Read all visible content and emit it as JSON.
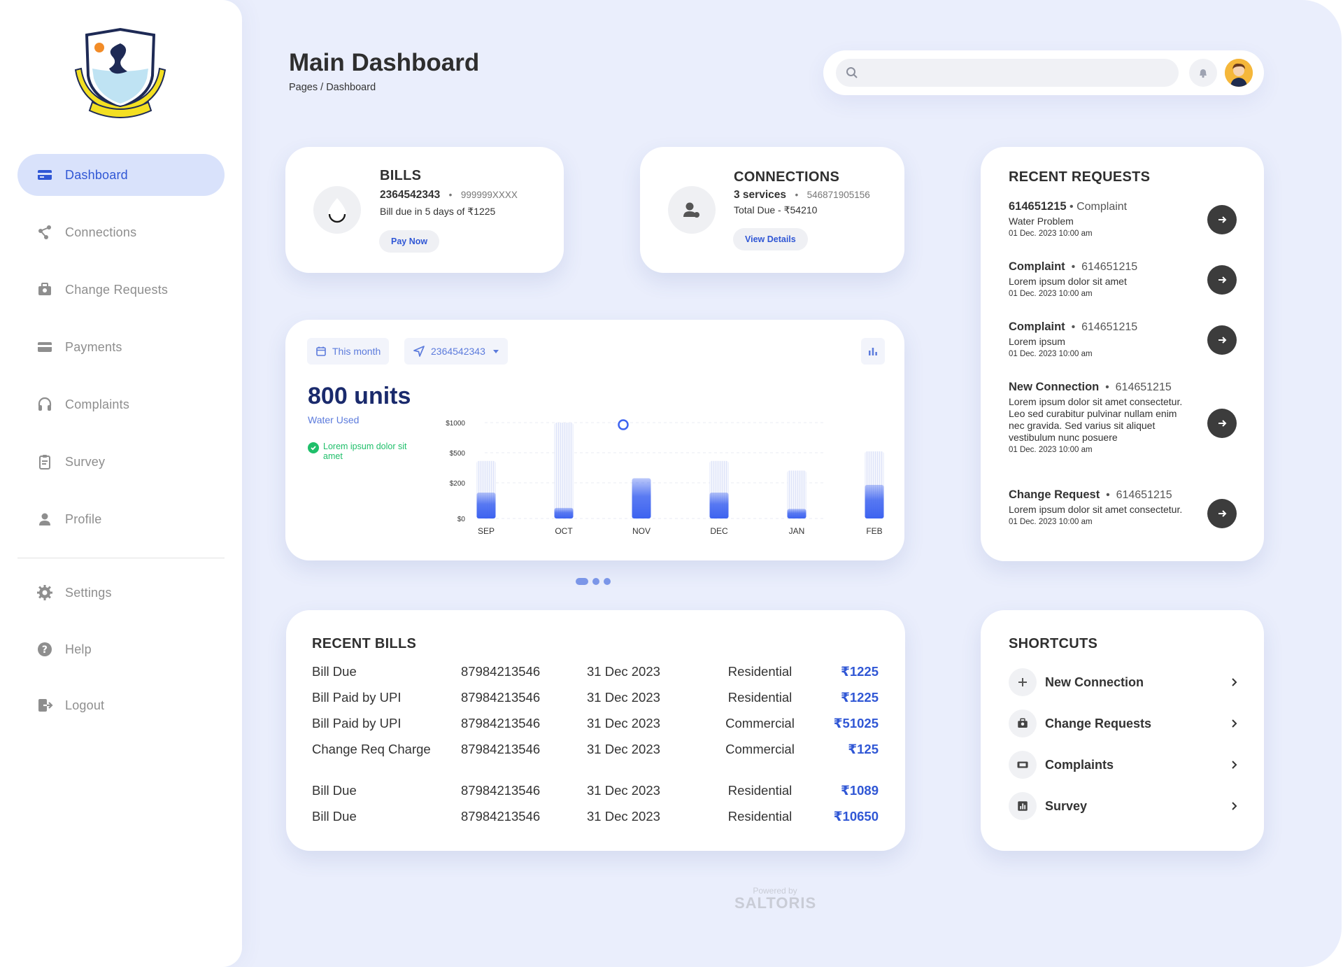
{
  "header": {
    "title": "Main Dashboard",
    "breadcrumb": "Pages / Dashboard",
    "search_placeholder": ""
  },
  "sidebar": {
    "items": [
      {
        "label": "Dashboard",
        "icon": "card-icon",
        "active": true
      },
      {
        "label": "Connections",
        "icon": "connection-icon"
      },
      {
        "label": "Change Requests",
        "icon": "briefcase-icon"
      },
      {
        "label": "Payments",
        "icon": "payment-card-icon"
      },
      {
        "label": "Complaints",
        "icon": "headset-icon"
      },
      {
        "label": "Survey",
        "icon": "clipboard-icon"
      },
      {
        "label": "Profile",
        "icon": "person-icon"
      }
    ],
    "bottom_items": [
      {
        "label": "Settings",
        "icon": "gear-icon"
      },
      {
        "label": "Help",
        "icon": "help-icon"
      },
      {
        "label": "Logout",
        "icon": "logout-icon"
      }
    ]
  },
  "bills_card": {
    "title": "BILLS",
    "number": "2364542343",
    "sep": "•",
    "masked": "999999XXXX",
    "due_text": "Bill due in 5 days of ₹1225",
    "button": "Pay Now"
  },
  "connections_card": {
    "title": "CONNECTIONS",
    "services": "3 services",
    "sep": "•",
    "number": "546871905156",
    "total": "Total Due - ₹54210",
    "button": "View Details"
  },
  "recent_requests": {
    "title": "RECENT REQUESTS",
    "items": [
      {
        "type": "614651215",
        "sep": " • ",
        "id": "Complaint",
        "body": "Water Problem",
        "date": "01 Dec. 2023 10:00 am"
      },
      {
        "type": "Complaint",
        "sep": "  •  ",
        "id": "614651215",
        "body": "Lorem ipsum dolor sit amet",
        "date": "01 Dec. 2023 10:00 am"
      },
      {
        "type": "Complaint",
        "sep": "  •  ",
        "id": "614651215",
        "body": "Lorem ipsum",
        "date": "01 Dec. 2023 10:00 am"
      },
      {
        "type": "New Connection",
        "sep": "  •  ",
        "id": "614651215",
        "body": "Lorem ipsum dolor sit amet consectetur. Leo sed curabitur pulvinar nullam enim nec gravida. Sed varius sit aliquet vestibulum nunc posuere",
        "date": "01 Dec. 2023 10:00 am"
      },
      {
        "type": "Change Request",
        "sep": "  •  ",
        "id": "614651215",
        "body": "Lorem ipsum dolor sit amet consectetur.",
        "date": "01 Dec. 2023 10:00 am"
      }
    ]
  },
  "usage": {
    "period_chip": "This month",
    "account_chip": "2364542343",
    "units": "800 units",
    "caption": "Water Used",
    "status_text": "Lorem ipsum dolor sit amet"
  },
  "chart_data": {
    "type": "bar",
    "categories": [
      "SEP",
      "OCT",
      "NOV",
      "DEC",
      "JAN",
      "FEB"
    ],
    "series": [
      {
        "values": [
          270,
          110,
          420,
          270,
          100,
          350
        ]
      }
    ],
    "background_values": [
      600,
      1000,
      0,
      600,
      500,
      700
    ],
    "tick_labels": [
      "$1000",
      "$500",
      "$200",
      "$0"
    ],
    "ylim": [
      0,
      1000
    ],
    "grid": true,
    "colors": {
      "bar": "#3d63f0",
      "bg_bar": "#dfe6fb",
      "marker": "#3d63f0"
    }
  },
  "pager": {
    "count": 3,
    "active": 0
  },
  "recent_bills": {
    "title": "RECENT BILLS",
    "rows": [
      {
        "desc": "Bill Due",
        "account": "87984213546",
        "date": "31 Dec 2023",
        "category": "Residential",
        "amount": "₹1225"
      },
      {
        "desc": "Bill Paid by UPI",
        "account": "87984213546",
        "date": "31 Dec 2023",
        "category": "Residential",
        "amount": "₹1225"
      },
      {
        "desc": "Bill Paid by UPI",
        "account": "87984213546",
        "date": "31 Dec 2023",
        "category": "Commercial",
        "amount": "₹51025"
      },
      {
        "desc": "Change Req Charge",
        "account": "87984213546",
        "date": "31 Dec 2023",
        "category": "Commercial",
        "amount": "₹125"
      },
      {
        "desc": "Bill Due",
        "account": "87984213546",
        "date": "31 Dec 2023",
        "category": "Residential",
        "amount": "₹1089"
      },
      {
        "desc": "Bill Due",
        "account": "87984213546",
        "date": "31 Dec 2023",
        "category": "Residential",
        "amount": "₹10650"
      }
    ]
  },
  "shortcuts": {
    "title": "SHORTCUTS",
    "items": [
      {
        "label": "New Connection",
        "icon": "plus-icon"
      },
      {
        "label": "Change Requests",
        "icon": "briefcase-icon"
      },
      {
        "label": "Complaints",
        "icon": "ticket-icon"
      },
      {
        "label": "Survey",
        "icon": "chart-icon"
      }
    ]
  },
  "footer": {
    "powered_by": "Powered by",
    "brand": "SALTORIS"
  }
}
